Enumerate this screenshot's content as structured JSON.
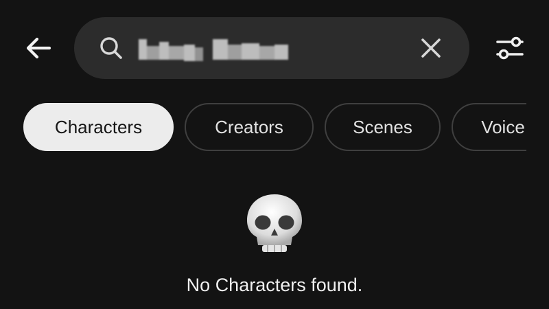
{
  "header": {
    "back_icon": "arrow-left-icon",
    "search": {
      "icon": "search-icon",
      "value": "",
      "query_redacted": true,
      "clear_icon": "close-icon"
    },
    "filter_icon": "sliders-icon"
  },
  "tabs": [
    {
      "label": "Characters",
      "active": true
    },
    {
      "label": "Creators",
      "active": false
    },
    {
      "label": "Scenes",
      "active": false
    },
    {
      "label": "Voice",
      "active": false
    }
  ],
  "empty_state": {
    "emoji": "💀",
    "message": "No Characters found."
  },
  "colors": {
    "background": "#131313",
    "search_bg": "#2c2c2c",
    "tab_border": "#3f3f3f",
    "active_tab_bg": "#ececec",
    "text": "#ececec"
  }
}
